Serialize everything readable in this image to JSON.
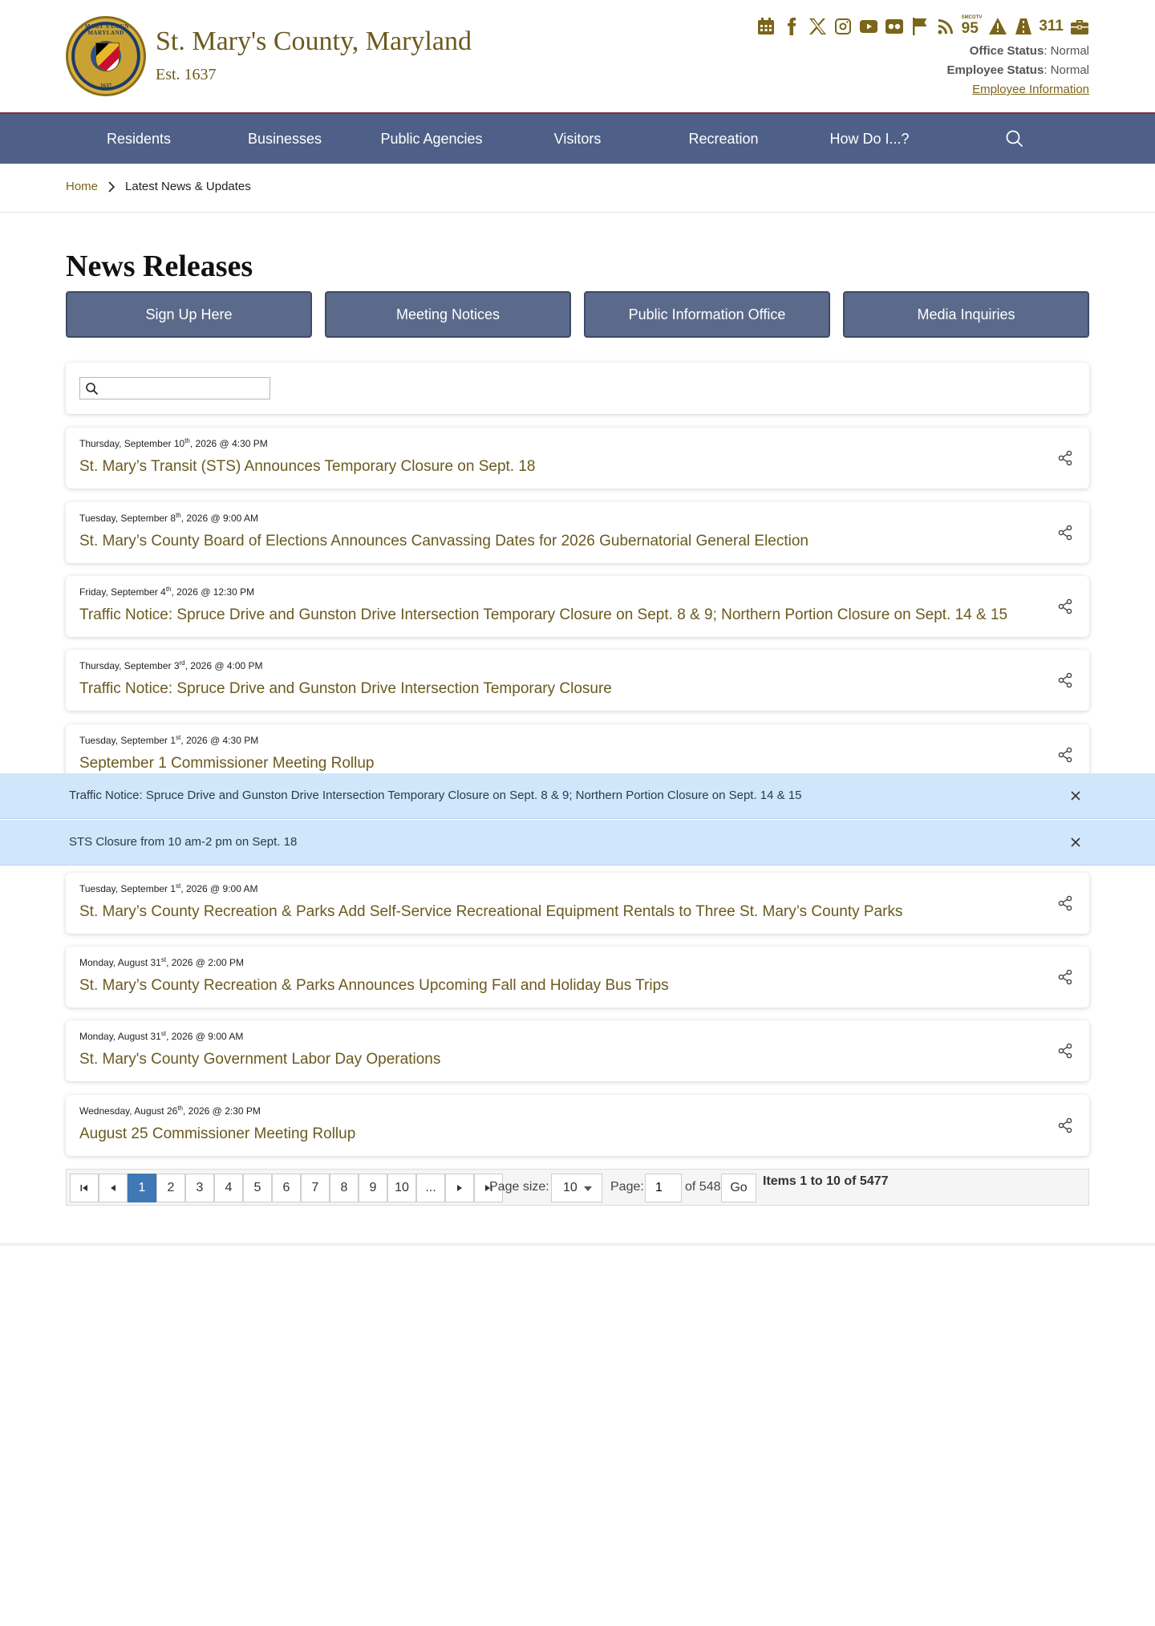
{
  "site": {
    "title": "St. Mary's County, Maryland",
    "est": "Est. 1637",
    "seal_text": "ST. MARY'S COUNTY MARYLAND",
    "seal_year": "1637"
  },
  "header": {
    "icons": [
      "calendar-icon",
      "facebook-icon",
      "x-icon",
      "instagram-icon",
      "youtube-icon",
      "flickr-icon",
      "flag-icon",
      "rss-icon"
    ],
    "smcgov_label": "95",
    "smcgov_small": "SMCGTV",
    "label_311": "311",
    "office_status_label": "Office Status",
    "office_status_value": "Normal",
    "employee_status_label": "Employee Status",
    "employee_status_value": "Normal",
    "employee_link": "Employee Information"
  },
  "nav": {
    "items": [
      {
        "label": "Residents"
      },
      {
        "label": "Businesses"
      },
      {
        "label": "Public Agencies"
      },
      {
        "label": "Visitors"
      },
      {
        "label": "Recreation"
      },
      {
        "label": "How Do I...?"
      }
    ]
  },
  "breadcrumb": {
    "home": "Home",
    "current": "Latest News & Updates"
  },
  "page": {
    "title": "News Releases",
    "buttons": [
      {
        "label": "Sign Up Here"
      },
      {
        "label": "Meeting Notices"
      },
      {
        "label": "Public Information Office"
      },
      {
        "label": "Media Inquiries"
      }
    ],
    "search": {
      "value": "",
      "placeholder": ""
    }
  },
  "news": [
    {
      "day": "Thursday, September 10",
      "suffix": "th",
      "rest": ", 2026 @ 4:30 PM",
      "title": "St. Mary’s Transit (STS) Announces Temporary Closure on Sept. 18"
    },
    {
      "day": "Tuesday, September 8",
      "suffix": "th",
      "rest": ", 2026 @ 9:00 AM",
      "title": "St. Mary’s County Board of Elections Announces Canvassing Dates for 2026 Gubernatorial General Election"
    },
    {
      "day": "Friday, September 4",
      "suffix": "th",
      "rest": ", 2026 @ 12:30 PM",
      "title": "Traffic Notice: Spruce Drive and Gunston Drive Intersection Temporary Closure on Sept. 8 & 9; Northern Portion Closure on Sept. 14 & 15"
    },
    {
      "day": "Thursday, September 3",
      "suffix": "rd",
      "rest": ", 2026 @ 4:00 PM",
      "title": "Traffic Notice: Spruce Drive and Gunston Drive Intersection Temporary Closure"
    },
    {
      "day": "Tuesday, September 1",
      "suffix": "st",
      "rest": ", 2026 @ 4:30 PM",
      "title": "September 1 Commissioner Meeting Rollup"
    },
    {
      "day": "Tuesday, September 1",
      "suffix": "st",
      "rest": ", 2026 @ 9:00 AM",
      "title": "St. Mary’s County Recreation & Parks Add Self-Service Recreational Equipment Rentals to Three St. Mary’s County Parks"
    },
    {
      "day": "Monday, August 31",
      "suffix": "st",
      "rest": ", 2026 @ 2:00 PM",
      "title": "St. Mary’s County Recreation & Parks Announces Upcoming Fall and Holiday Bus Trips"
    },
    {
      "day": "Monday, August 31",
      "suffix": "st",
      "rest": ", 2026 @ 9:00 AM",
      "title": "St. Mary's County Government Labor Day Operations"
    },
    {
      "day": "Wednesday, August 26",
      "suffix": "th",
      "rest": ", 2026 @ 2:30 PM",
      "title": "August 25 Commissioner Meeting Rollup"
    }
  ],
  "alerts": [
    {
      "text": "Traffic Notice: Spruce Drive and Gunston Drive Intersection Temporary Closure on Sept. 8 & 9; Northern Portion Closure on Sept. 14 & 15"
    },
    {
      "text": "STS Closure from 10 am-2 pm on Sept. 18"
    }
  ],
  "pager": {
    "pages": [
      "1",
      "2",
      "3",
      "4",
      "5",
      "6",
      "7",
      "8",
      "9",
      "10",
      "..."
    ],
    "current_page": 1,
    "page_size_label": "Page size:",
    "page_size_value": "10",
    "page_label": "Page:",
    "page_value": "1",
    "of_label": "of 548",
    "go_label": "Go",
    "items_label": "Items 1 to 10 of 5477"
  },
  "colors": {
    "gold": "#7a651a",
    "nav": "#4e6087",
    "button": "#5b6a8a",
    "alert": "#cfe6fb",
    "pager_active": "#3f78b5"
  }
}
